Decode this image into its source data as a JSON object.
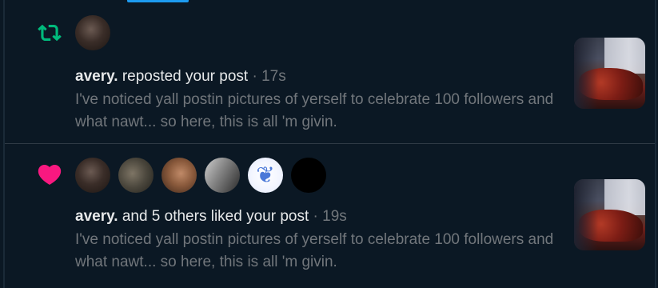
{
  "colors": {
    "background": "#0b1824",
    "accent": "#1d9bf0",
    "repost": "#00ba7c",
    "like": "#f91880",
    "muted_text": "#71767b",
    "primary_text": "#e7e9ea"
  },
  "notifications": [
    {
      "type_icon": "repost-icon",
      "user_name": "avery.",
      "action_text": "reposted your post",
      "separator": "·",
      "time": "17s",
      "post_text": "I've noticed yall postin pictures of yerself to celebrate 100 followers and what nawt... so here, this is all 'm givin.",
      "avatar_count": 1
    },
    {
      "type_icon": "heart-icon",
      "user_name": "avery.",
      "action_text": "and 5 others liked your post",
      "separator": "·",
      "time": "19s",
      "post_text": "I've noticed yall postin pictures of yerself to celebrate 100 followers and what nawt... so here, this is all 'm givin.",
      "avatar_count": 6
    }
  ]
}
